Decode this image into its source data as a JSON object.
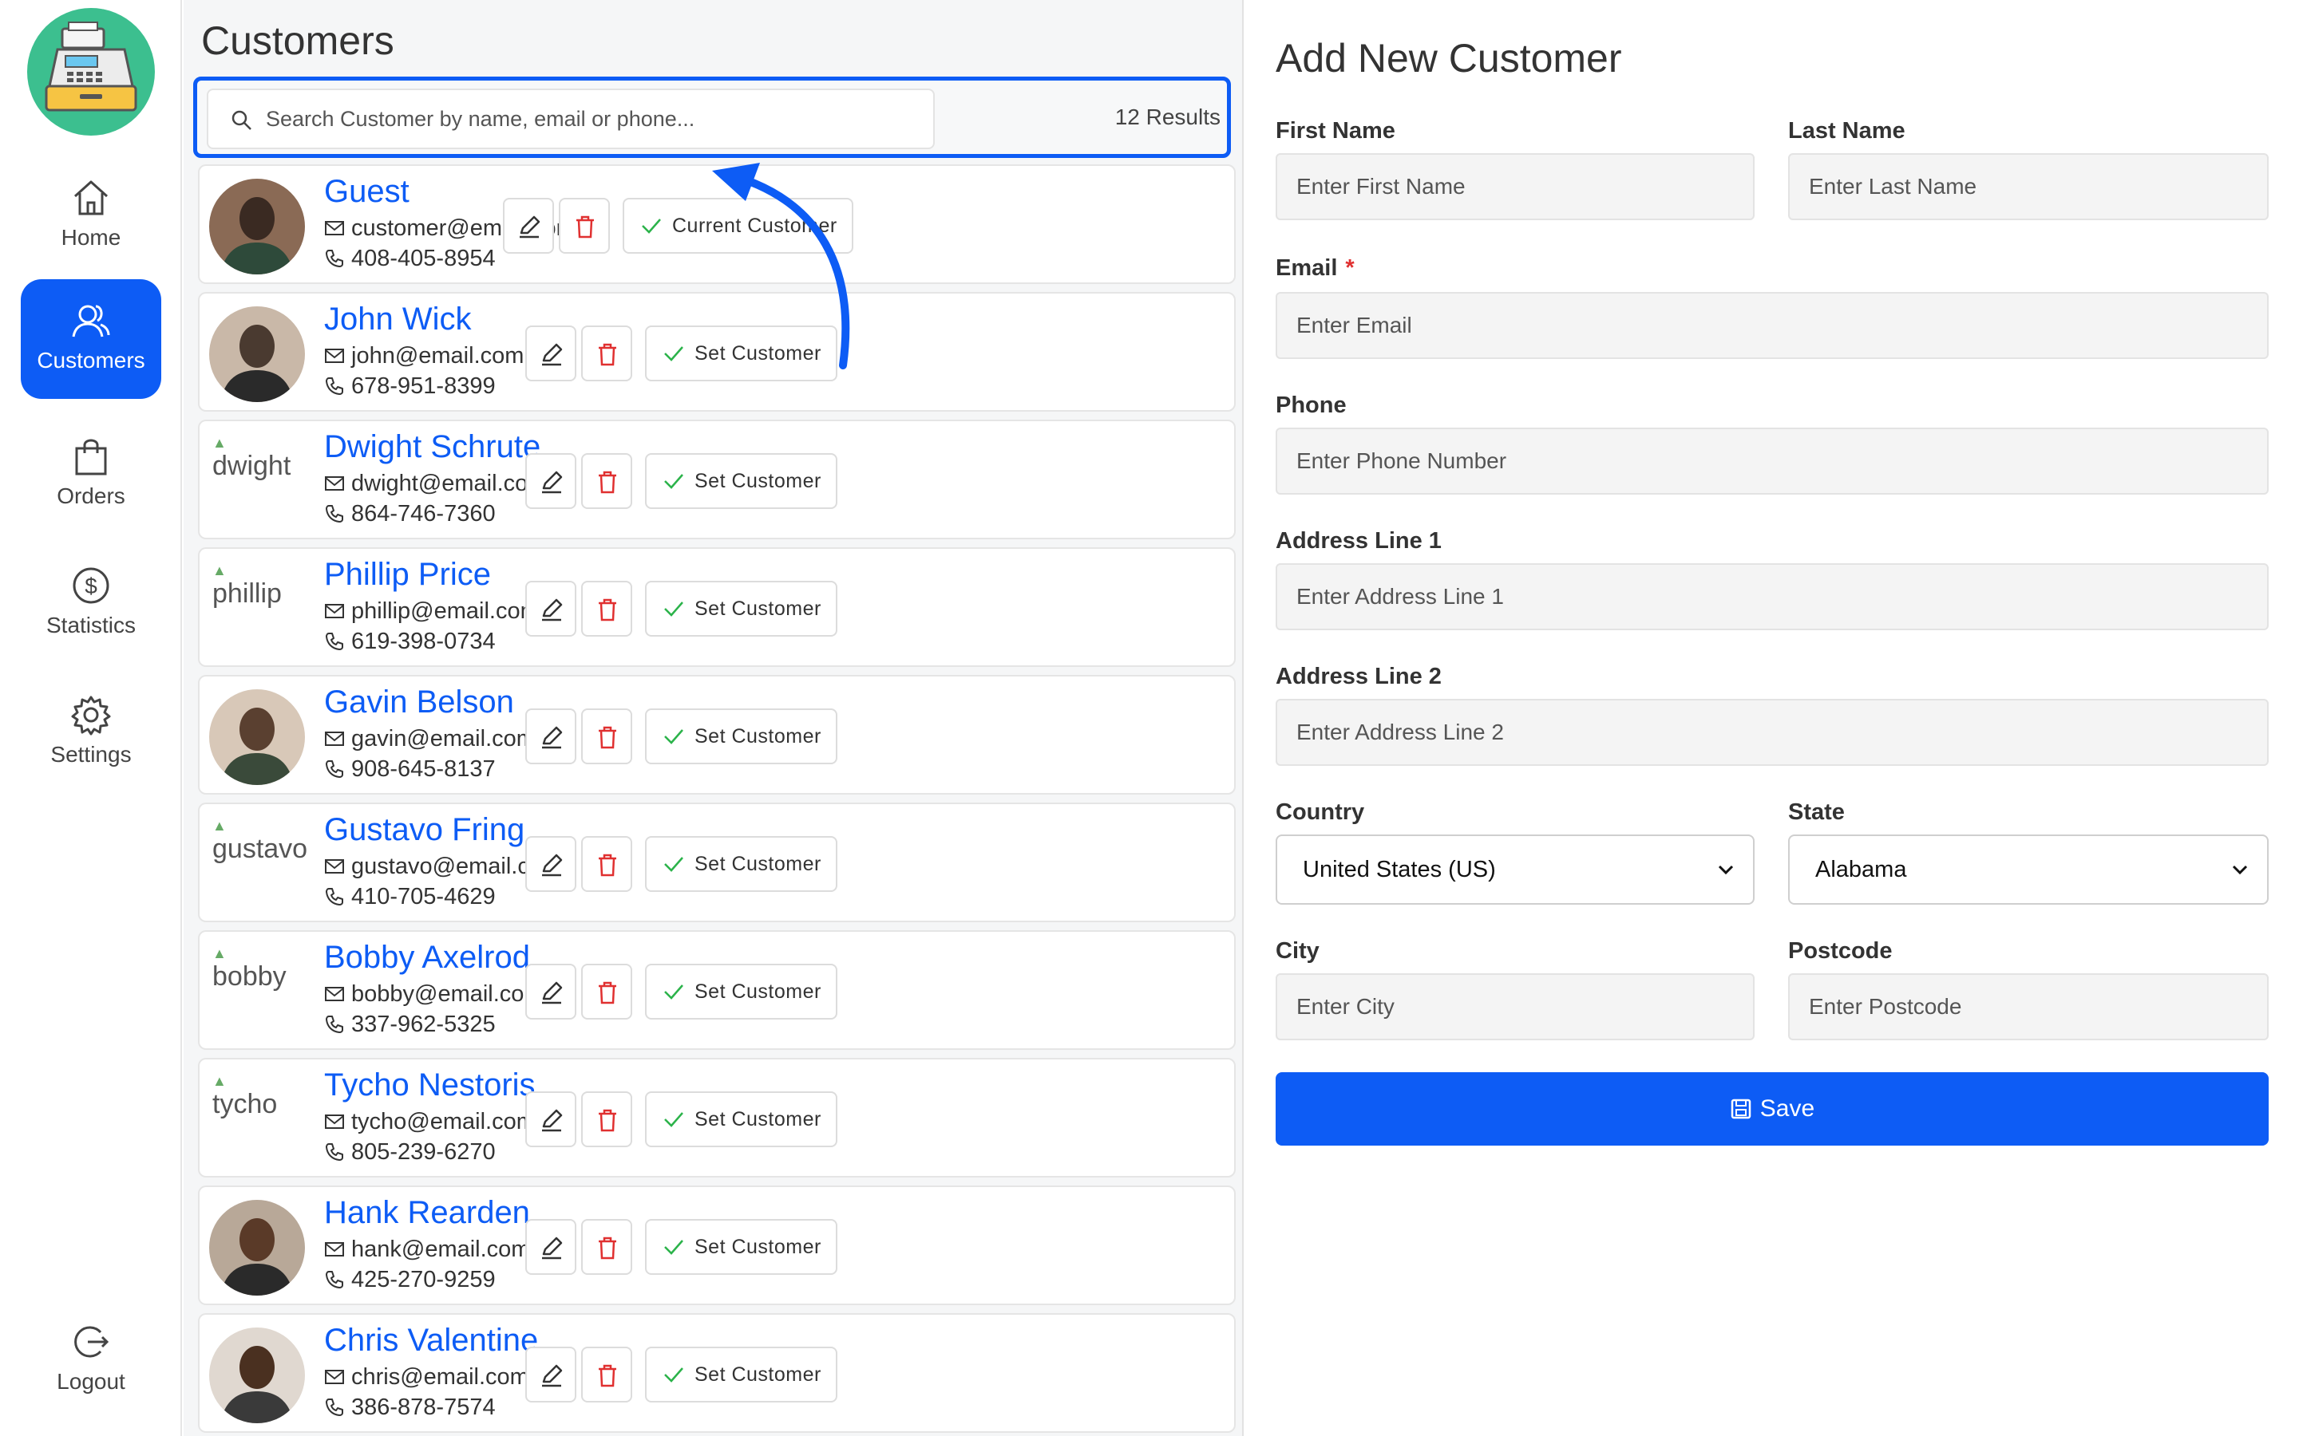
{
  "sidebar": {
    "items": [
      {
        "label": "Home",
        "icon": "home-icon"
      },
      {
        "label": "Customers",
        "icon": "customers-icon",
        "active": true
      },
      {
        "label": "Orders",
        "icon": "orders-icon"
      },
      {
        "label": "Statistics",
        "icon": "dollar-icon"
      },
      {
        "label": "Settings",
        "icon": "gear-icon"
      }
    ],
    "logout_label": "Logout",
    "logo_icon": "cash-register-icon"
  },
  "customers": {
    "title": "Customers",
    "search_placeholder": "Search Customer by name, email or phone...",
    "results": "12 Results",
    "list": [
      {
        "name": "Guest",
        "email": "customer@email.com",
        "phone": "408-405-8954",
        "action": "Current Customer",
        "avatar": "photo"
      },
      {
        "name": "John Wick",
        "email": "john@email.com",
        "phone": "678-951-8399",
        "action": "Set Customer",
        "avatar": "photo"
      },
      {
        "name": "Dwight Schrute",
        "email": "dwight@email.com",
        "phone": "864-746-7360",
        "action": "Set Customer",
        "avatar": "broken",
        "alt": "dwight"
      },
      {
        "name": "Phillip Price",
        "email": "phillip@email.com",
        "phone": "619-398-0734",
        "action": "Set Customer",
        "avatar": "broken",
        "alt": "phillip"
      },
      {
        "name": "Gavin Belson",
        "email": "gavin@email.com",
        "phone": "908-645-8137",
        "action": "Set Customer",
        "avatar": "photo"
      },
      {
        "name": "Gustavo Fring",
        "email": "gustavo@email.com",
        "phone": "410-705-4629",
        "action": "Set Customer",
        "avatar": "broken",
        "alt": "gustavo"
      },
      {
        "name": "Bobby Axelrod",
        "email": "bobby@email.com",
        "phone": "337-962-5325",
        "action": "Set Customer",
        "avatar": "broken",
        "alt": "bobby"
      },
      {
        "name": "Tycho Nestoris",
        "email": "tycho@email.com",
        "phone": "805-239-6270",
        "action": "Set Customer",
        "avatar": "broken",
        "alt": "tycho"
      },
      {
        "name": "Hank Rearden",
        "email": "hank@email.com",
        "phone": "425-270-9259",
        "action": "Set Customer",
        "avatar": "photo"
      },
      {
        "name": "Chris Valentine",
        "email": "chris@email.com",
        "phone": "386-878-7574",
        "action": "Set Customer",
        "avatar": "photo"
      }
    ]
  },
  "form": {
    "title": "Add New Customer",
    "first_name": {
      "label": "First Name",
      "placeholder": "Enter First Name"
    },
    "last_name": {
      "label": "Last Name",
      "placeholder": "Enter Last Name"
    },
    "email": {
      "label": "Email",
      "required_mark": "*",
      "placeholder": "Enter Email"
    },
    "phone": {
      "label": "Phone",
      "placeholder": "Enter Phone Number"
    },
    "address1": {
      "label": "Address Line 1",
      "placeholder": "Enter Address Line 1"
    },
    "address2": {
      "label": "Address Line 2",
      "placeholder": "Enter Address Line 2"
    },
    "country": {
      "label": "Country",
      "value": "United States (US)"
    },
    "state": {
      "label": "State",
      "value": "Alabama"
    },
    "city": {
      "label": "City",
      "placeholder": "Enter City"
    },
    "postcode": {
      "label": "Postcode",
      "placeholder": "Enter Postcode"
    },
    "save_label": "Save"
  },
  "colors": {
    "accent": "#0d5cf5",
    "delete": "#e03030",
    "check": "#2bb34a",
    "logo_bg": "#3cbf8f"
  }
}
